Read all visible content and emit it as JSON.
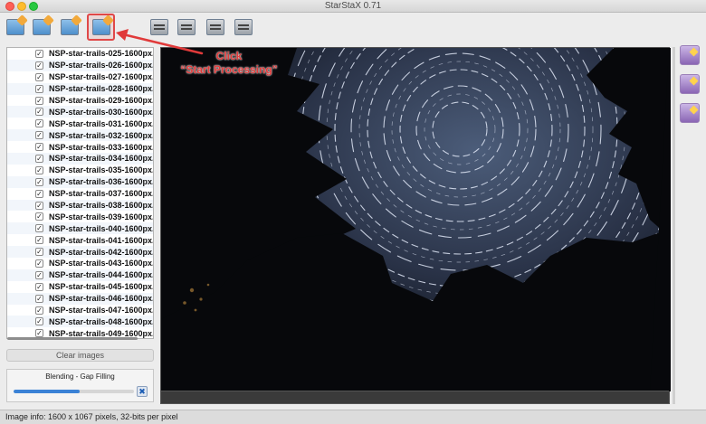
{
  "window": {
    "title": "StarStaX 0.71"
  },
  "toolbar": {
    "buttons": [
      {
        "name": "open-images-button",
        "icon": "folder-open-icon"
      },
      {
        "name": "open-dark-frames-button",
        "icon": "folder-dark-icon"
      },
      {
        "name": "save-image-button",
        "icon": "folder-save-icon"
      },
      {
        "name": "start-processing-button",
        "icon": "start-processing-icon"
      },
      {
        "name": "zoom-in-button",
        "icon": "zoom-in-icon"
      },
      {
        "name": "zoom-out-button",
        "icon": "zoom-out-icon"
      },
      {
        "name": "fit-to-window-button",
        "icon": "fit-window-icon"
      },
      {
        "name": "actual-size-button",
        "icon": "actual-size-icon"
      }
    ]
  },
  "annotation": {
    "line1": "Click",
    "line2": "“Start Processing”",
    "color": "#e03a3a"
  },
  "files": [
    {
      "name": "NSP-star-trails-025-1600px.",
      "checked": true
    },
    {
      "name": "NSP-star-trails-026-1600px.",
      "checked": true
    },
    {
      "name": "NSP-star-trails-027-1600px.",
      "checked": true
    },
    {
      "name": "NSP-star-trails-028-1600px.",
      "checked": true
    },
    {
      "name": "NSP-star-trails-029-1600px.",
      "checked": true
    },
    {
      "name": "NSP-star-trails-030-1600px.",
      "checked": true
    },
    {
      "name": "NSP-star-trails-031-1600px.",
      "checked": true
    },
    {
      "name": "NSP-star-trails-032-1600px.",
      "checked": true
    },
    {
      "name": "NSP-star-trails-033-1600px.",
      "checked": true
    },
    {
      "name": "NSP-star-trails-034-1600px.",
      "checked": true
    },
    {
      "name": "NSP-star-trails-035-1600px.",
      "checked": true
    },
    {
      "name": "NSP-star-trails-036-1600px.",
      "checked": true
    },
    {
      "name": "NSP-star-trails-037-1600px.",
      "checked": true
    },
    {
      "name": "NSP-star-trails-038-1600px.",
      "checked": true
    },
    {
      "name": "NSP-star-trails-039-1600px.",
      "checked": true
    },
    {
      "name": "NSP-star-trails-040-1600px.",
      "checked": true
    },
    {
      "name": "NSP-star-trails-041-1600px.",
      "checked": true
    },
    {
      "name": "NSP-star-trails-042-1600px.",
      "checked": true
    },
    {
      "name": "NSP-star-trails-043-1600px.",
      "checked": true
    },
    {
      "name": "NSP-star-trails-044-1600px.",
      "checked": true
    },
    {
      "name": "NSP-star-trails-045-1600px.",
      "checked": true
    },
    {
      "name": "NSP-star-trails-046-1600px.",
      "checked": true
    },
    {
      "name": "NSP-star-trails-047-1600px.",
      "checked": true
    },
    {
      "name": "NSP-star-trails-048-1600px.",
      "checked": true
    },
    {
      "name": "NSP-star-trails-049-1600px.",
      "checked": true
    }
  ],
  "controls": {
    "clear_label": "Clear images"
  },
  "progress": {
    "label": "Blending - Gap Filling",
    "fraction": 0.55,
    "color": "#3b82d6"
  },
  "sidebar": {
    "buttons": [
      {
        "name": "side-button-1",
        "icon": "star-icon"
      },
      {
        "name": "side-button-2",
        "icon": "wand-icon"
      },
      {
        "name": "side-button-3",
        "icon": "sparkle-icon"
      }
    ]
  },
  "status": {
    "text": "Image info: 1600 x 1067 pixels, 32-bits per pixel"
  }
}
